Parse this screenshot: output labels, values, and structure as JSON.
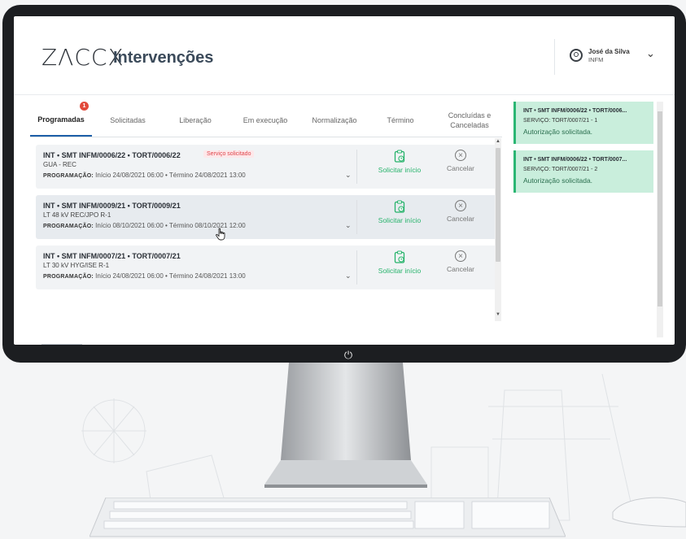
{
  "app": {
    "logo": "ZΛCCX",
    "title": "Intervenções"
  },
  "user": {
    "name": "José da Silva",
    "role": "INFM"
  },
  "tabs": [
    {
      "label": "Programadas",
      "badge": "1",
      "active": true
    },
    {
      "label": "Solicitadas"
    },
    {
      "label": "Liberação"
    },
    {
      "label": "Em execução"
    },
    {
      "label": "Normalização"
    },
    {
      "label": "Término"
    },
    {
      "label": "Concluídas e Canceladas"
    }
  ],
  "cards": [
    {
      "title": "INT • SMT INFM/0006/22 • TORT/0006/22",
      "tag": "Serviço solicitado",
      "sub": "GUA - REC",
      "prog_label": "PROGRAMAÇÃO:",
      "prog_text": "Início 24/08/2021 06:00 • Término 24/08/2021 13:00",
      "start_label": "Solicitar início",
      "cancel_label": "Cancelar"
    },
    {
      "title": "INT • SMT INFM/0009/21 • TORT/0009/21",
      "sub": "LT 48 kV REC/JPO R-1",
      "prog_label": "PROGRAMAÇÃO:",
      "prog_text": "Início 08/10/2021 06:00 • Término 08/10/2021 12:00",
      "start_label": "Solicitar início",
      "cancel_label": "Cancelar"
    },
    {
      "title": "INT • SMT INFM/0007/21 • TORT/0007/21",
      "sub": "LT 30 kV HYG/ISE R-1",
      "prog_label": "PROGRAMAÇÃO:",
      "prog_text": "Início 24/08/2021 06:00 • Término 24/08/2021 13:00",
      "start_label": "Solicitar início",
      "cancel_label": "Cancelar"
    }
  ],
  "notifications": [
    {
      "title": "INT • SMT INFM/0006/22 • TORT/0006...",
      "sub": "SERVIÇO: TORT/0007/21 - 1",
      "status": "Autorização solicitada."
    },
    {
      "title": "INT • SMT INFM/0006/22 • TORT/0007...",
      "sub": "SERVIÇO: TORT/0007/21 - 2",
      "status": "Autorização solicitada."
    }
  ],
  "icons": {
    "user": "user-circle-icon",
    "chevron": "chevron-down-icon",
    "start": "clipboard-clock-icon",
    "cancel": "close-circle-icon",
    "power": "power-icon"
  },
  "colors": {
    "accent": "#1d5fa8",
    "success": "#27b36b",
    "notification_bg": "#c9eedc",
    "badge": "#e24a3b",
    "tag": "#e0454b"
  }
}
